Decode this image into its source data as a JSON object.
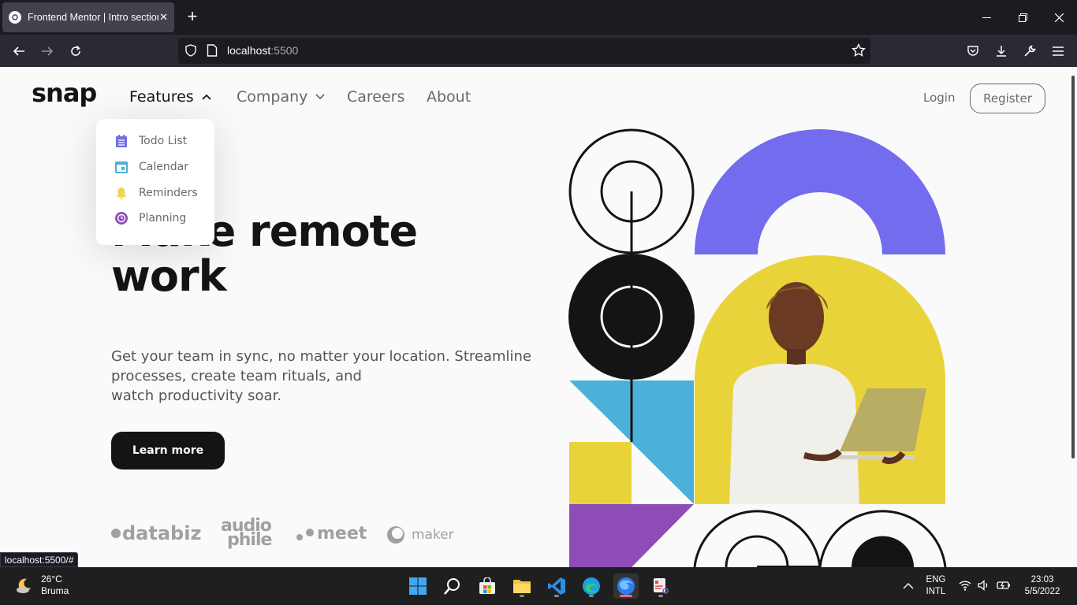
{
  "browser": {
    "tab_title": "Frontend Mentor | Intro section with dropdown navigation",
    "tab_close": "✕",
    "new_tab": "+",
    "url_host": "localhost",
    "url_port": ":5500",
    "status_url": "localhost:5500/#"
  },
  "site": {
    "logo": "snap",
    "nav": {
      "features": "Features",
      "company": "Company",
      "careers": "Careers",
      "about": "About"
    },
    "login": "Login",
    "register": "Register",
    "features_menu": [
      {
        "label": "Todo List",
        "icon": "todo-icon",
        "color": "#726cee"
      },
      {
        "label": "Calendar",
        "icon": "calendar-icon",
        "color": "#4bb1da"
      },
      {
        "label": "Reminders",
        "icon": "bell-icon",
        "color": "#edd556"
      },
      {
        "label": "Planning",
        "icon": "planning-icon",
        "color": "#8e4cb6"
      }
    ],
    "hero": {
      "title_line1": "Make remote",
      "title_line2": "work",
      "text_line1": "Get your team in sync, no matter your location. Streamline",
      "text_line2": "processes, create team rituals, and",
      "text_line3": "watch productivity soar.",
      "cta": "Learn more"
    },
    "clients": [
      "databiz",
      "audio",
      "phile",
      "meet",
      "maker"
    ]
  },
  "taskbar": {
    "weather_temp": "26°C",
    "weather_place": "Bruma",
    "lang_line1": "ENG",
    "lang_line2": "INTL",
    "time": "23:03",
    "date": "5/5/2022"
  },
  "colors": {
    "purple": "#736cee",
    "yellow": "#e9d33a",
    "blue": "#4bb1da",
    "violet": "#8e4cb6",
    "dark": "#141414"
  }
}
